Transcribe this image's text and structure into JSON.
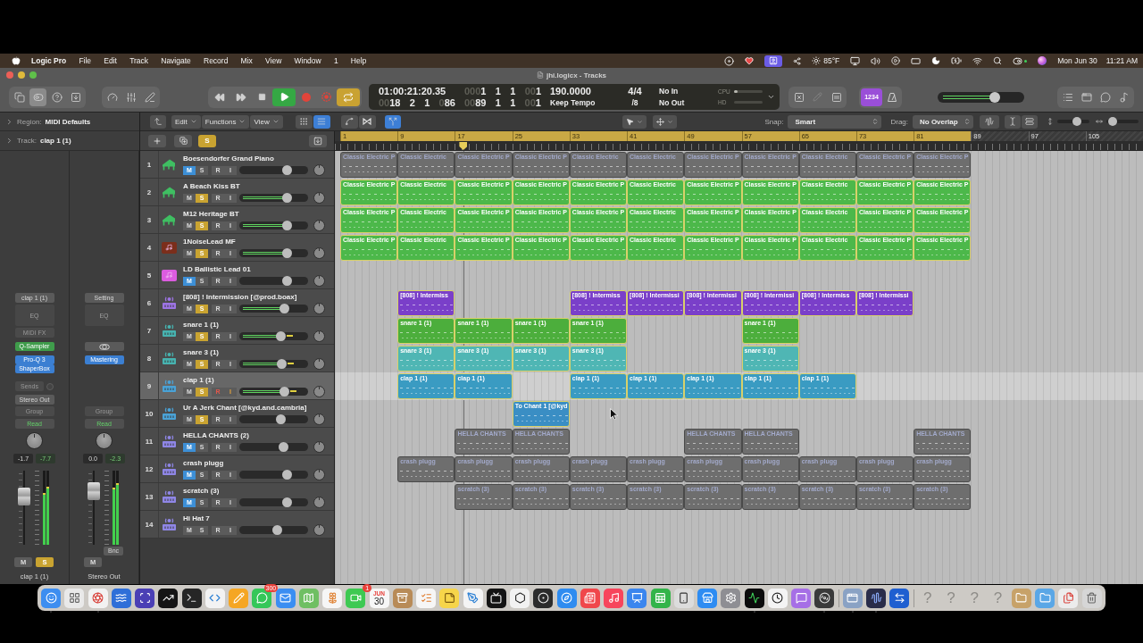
{
  "menubar": {
    "app": "Logic Pro",
    "menus": [
      "File",
      "Edit",
      "Track",
      "Navigate",
      "Record",
      "Mix",
      "View",
      "Window",
      "1",
      "Help"
    ],
    "weather": "85°F",
    "date": "Mon Jun 30",
    "time": "11:21 AM"
  },
  "window": {
    "title": "jhi.logicx - Tracks"
  },
  "toolbar": {
    "view_buttons": [
      {
        "kind": "library",
        "selected": false
      },
      {
        "kind": "inspector",
        "selected": true
      },
      {
        "kind": "help",
        "selected": false
      },
      {
        "kind": "download",
        "selected": false
      }
    ],
    "transport": {
      "playing": true,
      "cycle": true
    },
    "lcd": {
      "time": "01:00:21:20.35",
      "position": [
        {
          "dim": "00",
          "value": "18"
        },
        {
          "value": "2"
        },
        {
          "value": "1"
        },
        {
          "dim": "0",
          "value": "86"
        }
      ],
      "left_locator": [
        {
          "dim": "000",
          "value": "1"
        },
        {
          "value": "1"
        },
        {
          "value": "1"
        },
        {
          "dim": "00",
          "value": "1"
        }
      ],
      "right_locator": [
        {
          "dim": "00",
          "value": "89"
        },
        {
          "value": "1"
        },
        {
          "value": "1"
        },
        {
          "dim": "00",
          "value": "1"
        }
      ],
      "tempo": "190.0000",
      "tempo_mode": "Keep Tempo",
      "signature": "4/4",
      "division": "/8",
      "midi_in": "No In",
      "midi_out": "No Out",
      "cpu": {
        "label": "CPU",
        "level": 0.12
      },
      "hd": {
        "label": "HD"
      }
    },
    "count_in": {
      "label": "1234",
      "on": true
    },
    "master_volume": {
      "level": 0.66
    }
  },
  "inspector": {
    "region": {
      "label": "Region:",
      "value": "MIDI Defaults"
    },
    "track": {
      "label": "Track:",
      "value": "clap 1 (1)"
    }
  },
  "strips": [
    {
      "setting": "clap 1 (1)",
      "eq": "EQ",
      "midi_fx": "MIDI FX",
      "instrument": "Q-Sampler",
      "effects": [
        "Pro-Q 3",
        "ShaperBox"
      ],
      "sends": "Sends",
      "output": "Stereo Out",
      "group": "Group",
      "automation": "Read",
      "values": [
        "-1.7",
        "-7.7"
      ],
      "fader": {
        "level": 0.65
      },
      "meters": [
        {
          "level": 0.7
        },
        {
          "level": 0.78
        }
      ],
      "buttons": [
        {
          "kind": "mute",
          "label": "M",
          "on": false
        },
        {
          "kind": "solo",
          "label": "S",
          "on": true
        }
      ],
      "name": "clap 1 (1)"
    },
    {
      "setting": "Setting",
      "eq": "EQ",
      "stereo_link": true,
      "effects": [
        "Mastering"
      ],
      "group": "Group",
      "automation": "Read",
      "values": [
        "0.0",
        "-2.3"
      ],
      "fader": {
        "level": 0.72
      },
      "meters": [
        {
          "level": 0.77
        },
        {
          "level": 0.83
        }
      ],
      "bounce": "Bnc",
      "buttons": [
        {
          "kind": "mute",
          "label": "M",
          "on": false
        }
      ],
      "name": "Stereo Out"
    }
  ],
  "edit_toolbar": {
    "menus": [
      "Edit",
      "Functions",
      "View"
    ],
    "view_buttons": [
      {
        "selected": false
      },
      {
        "selected": true
      }
    ],
    "catch": {
      "on": true
    },
    "snap_label": "Snap:",
    "snap": "Smart",
    "drag_label": "Drag:",
    "drag": "No Overlap",
    "vertical_zoom": {
      "level": 0.6
    },
    "horizontal_zoom": {
      "level": 0.2
    }
  },
  "track_list": {
    "solo": {
      "label": "S",
      "on": true
    }
  },
  "ruler": {
    "marks": [
      {
        "label": "1",
        "in_cycle": true
      },
      {
        "label": "9",
        "in_cycle": true
      },
      {
        "label": "17",
        "in_cycle": true
      },
      {
        "label": "25",
        "in_cycle": true
      },
      {
        "label": "33",
        "in_cycle": true
      },
      {
        "label": "41",
        "in_cycle": true
      },
      {
        "label": "49",
        "in_cycle": true
      },
      {
        "label": "57",
        "in_cycle": true
      },
      {
        "label": "65",
        "in_cycle": true
      },
      {
        "label": "73",
        "in_cycle": true
      },
      {
        "label": "81",
        "in_cycle": true
      },
      {
        "label": "89",
        "in_cycle": false
      },
      {
        "label": "97",
        "in_cycle": false
      },
      {
        "label": "105",
        "in_cycle": false
      }
    ]
  },
  "playhead": {
    "level": 0.159
  },
  "tracks": [
    {
      "number": "1",
      "name": "Boesendorfer Grand Piano",
      "icon": {
        "kind": "piano",
        "color": "#3fbf62"
      },
      "selected": false,
      "buttons": [
        {
          "kind": "mute",
          "label": "M",
          "on": true
        },
        {
          "kind": "solo",
          "label": "S",
          "on": false
        },
        {
          "kind": "record",
          "label": "R",
          "on": false
        },
        {
          "kind": "input",
          "label": "I",
          "on": false
        }
      ],
      "level": 0.7,
      "signal": false,
      "peak": false,
      "regions": [
        {
          "kind": "region",
          "name": "Classic Electric P"
        },
        {
          "kind": "region",
          "name": "Classic Electric"
        },
        {
          "kind": "region",
          "name": "Classic Electric P"
        },
        {
          "kind": "region",
          "name": "Classic Electric P"
        },
        {
          "kind": "region",
          "name": "Classic Electric"
        },
        {
          "kind": "region",
          "name": "Classic Electric"
        },
        {
          "kind": "region",
          "name": "Classic Electric P"
        },
        {
          "kind": "region",
          "name": "Classic Electric P"
        },
        {
          "kind": "region",
          "name": "Classic Electric"
        },
        {
          "kind": "region",
          "name": "Classic Electric P"
        },
        {
          "kind": "region",
          "name": "Classic Electric P"
        }
      ]
    },
    {
      "number": "2",
      "name": "A Beach Kiss BT",
      "icon": {
        "kind": "piano",
        "color": "#3fbf62"
      },
      "color": "#4cb84a",
      "selected": false,
      "buttons": [
        {
          "kind": "mute",
          "label": "M",
          "on": false
        },
        {
          "kind": "solo",
          "label": "S",
          "on": true
        },
        {
          "kind": "record",
          "label": "R",
          "on": false
        },
        {
          "kind": "input",
          "label": "I",
          "on": false
        }
      ],
      "level": 0.7,
      "signal": true,
      "peak": false,
      "regions": [
        {
          "kind": "region",
          "name": "Classic Electric P"
        },
        {
          "kind": "region",
          "name": "Classic Electric"
        },
        {
          "kind": "region",
          "name": "Classic Electric P"
        },
        {
          "kind": "region",
          "name": "Classic Electric P"
        },
        {
          "kind": "region",
          "name": "Classic Electric P"
        },
        {
          "kind": "region",
          "name": "Classic Electric"
        },
        {
          "kind": "region",
          "name": "Classic Electric P"
        },
        {
          "kind": "region",
          "name": "Classic Electric P"
        },
        {
          "kind": "region",
          "name": "Classic Electric"
        },
        {
          "kind": "region",
          "name": "Classic Electric P"
        },
        {
          "kind": "region",
          "name": "Classic Electric P"
        }
      ]
    },
    {
      "number": "3",
      "name": "M12 Heritage BT",
      "icon": {
        "kind": "piano",
        "color": "#3fbf62"
      },
      "color": "#4cb84a",
      "selected": false,
      "buttons": [
        {
          "kind": "mute",
          "label": "M",
          "on": false
        },
        {
          "kind": "solo",
          "label": "S",
          "on": true
        },
        {
          "kind": "record",
          "label": "R",
          "on": false
        },
        {
          "kind": "input",
          "label": "I",
          "on": false
        }
      ],
      "level": 0.7,
      "signal": true,
      "peak": false,
      "regions": [
        {
          "kind": "region",
          "name": "Classic Electric P"
        },
        {
          "kind": "region",
          "name": "Classic Electric"
        },
        {
          "kind": "region",
          "name": "Classic Electric P"
        },
        {
          "kind": "region",
          "name": "Classic Electric P"
        },
        {
          "kind": "region",
          "name": "Classic Electric P"
        },
        {
          "kind": "region",
          "name": "Classic Electric"
        },
        {
          "kind": "region",
          "name": "Classic Electric P"
        },
        {
          "kind": "region",
          "name": "Classic Electric P"
        },
        {
          "kind": "region",
          "name": "Classic Electric"
        },
        {
          "kind": "region",
          "name": "Classic Electric P"
        },
        {
          "kind": "region",
          "name": "Classic Electric P"
        }
      ]
    },
    {
      "number": "4",
      "name": "1NoiseLead MF",
      "icon": {
        "kind": "note",
        "color": "#7b2e1b"
      },
      "color": "#4cb84a",
      "selected": false,
      "buttons": [
        {
          "kind": "mute",
          "label": "M",
          "on": false
        },
        {
          "kind": "solo",
          "label": "S",
          "on": true
        },
        {
          "kind": "record",
          "label": "R",
          "on": false
        },
        {
          "kind": "input",
          "label": "I",
          "on": false
        }
      ],
      "level": 0.7,
      "signal": true,
      "peak": false,
      "regions": [
        {
          "kind": "region",
          "name": "Classic Electric P"
        },
        {
          "kind": "region",
          "name": "Classic Electric"
        },
        {
          "kind": "region",
          "name": "Classic Electric P"
        },
        {
          "kind": "region",
          "name": "Classic Electric P"
        },
        {
          "kind": "region",
          "name": "Classic Electric P"
        },
        {
          "kind": "region",
          "name": "Classic Electric"
        },
        {
          "kind": "region",
          "name": "Classic Electric P"
        },
        {
          "kind": "region",
          "name": "Classic Electric P"
        },
        {
          "kind": "region",
          "name": "Classic Electric"
        },
        {
          "kind": "region",
          "name": "Classic Electric P"
        },
        {
          "kind": "region",
          "name": "Classic Electric P"
        }
      ]
    },
    {
      "number": "5",
      "name": "LD Ballistic Lead 01",
      "icon": {
        "kind": "note",
        "color": "#dc5ce0"
      },
      "selected": false,
      "buttons": [
        {
          "kind": "mute",
          "label": "M",
          "on": true
        },
        {
          "kind": "solo",
          "label": "S",
          "on": false
        },
        {
          "kind": "record",
          "label": "R",
          "on": false
        },
        {
          "kind": "input",
          "label": "I",
          "on": false
        }
      ],
      "level": 0.7,
      "signal": false,
      "peak": false
    },
    {
      "number": "6",
      "name": "[808] ! Intermission [@prod.boax]",
      "icon": {
        "kind": "drums",
        "color": "#9d74e4"
      },
      "color": "#7a3fc9",
      "selected": false,
      "buttons": [
        {
          "kind": "mute",
          "label": "M",
          "on": false
        },
        {
          "kind": "solo",
          "label": "S",
          "on": true
        },
        {
          "kind": "record",
          "label": "R",
          "on": false
        },
        {
          "kind": "input",
          "label": "I",
          "on": false
        }
      ],
      "level": 0.66,
      "signal": true,
      "peak": false,
      "regions": [
        {
          "kind": "gap"
        },
        {
          "kind": "region",
          "name": "[808] ! Intermiss"
        },
        {
          "kind": "gap"
        },
        {
          "kind": "gap"
        },
        {
          "kind": "region",
          "name": "[808] ! Intermiss"
        },
        {
          "kind": "region",
          "name": "[808] ! Intermissi"
        },
        {
          "kind": "region",
          "name": "[808] ! Intermissi"
        },
        {
          "kind": "region",
          "name": "[808] ! Intermissi"
        },
        {
          "kind": "region",
          "name": "[808] ! Intermiss"
        },
        {
          "kind": "region",
          "name": "[808] ! Intermissi"
        }
      ]
    },
    {
      "number": "7",
      "name": "snare 1 (1)",
      "icon": {
        "kind": "drums",
        "color": "#47b3b0"
      },
      "color": "#4cae3c",
      "selected": false,
      "buttons": [
        {
          "kind": "mute",
          "label": "M",
          "on": false
        },
        {
          "kind": "solo",
          "label": "S",
          "on": true
        },
        {
          "kind": "record",
          "label": "R",
          "on": false
        },
        {
          "kind": "input",
          "label": "I",
          "on": false
        }
      ],
      "level": 0.61,
      "signal": true,
      "peak": true,
      "regions": [
        {
          "kind": "gap"
        },
        {
          "kind": "region",
          "name": "snare 1 (1)"
        },
        {
          "kind": "region",
          "name": "snare 1 (1)"
        },
        {
          "kind": "region",
          "name": "snare 1 (1)"
        },
        {
          "kind": "region",
          "name": "snare 1 (1)"
        },
        {
          "kind": "gap"
        },
        {
          "kind": "gap"
        },
        {
          "kind": "region",
          "name": "snare 1 (1)"
        }
      ]
    },
    {
      "number": "8",
      "name": "snare 3 (1)",
      "icon": {
        "kind": "drums",
        "color": "#47b3b0"
      },
      "color": "#4fb6b4",
      "selected": false,
      "buttons": [
        {
          "kind": "mute",
          "label": "M",
          "on": false
        },
        {
          "kind": "solo",
          "label": "S",
          "on": true
        },
        {
          "kind": "record",
          "label": "R",
          "on": false
        },
        {
          "kind": "input",
          "label": "I",
          "on": false
        }
      ],
      "level": 0.62,
      "signal": true,
      "peak": true,
      "regions": [
        {
          "kind": "gap"
        },
        {
          "kind": "region",
          "name": "snare 3 (1)"
        },
        {
          "kind": "region",
          "name": "snare 3 (1)"
        },
        {
          "kind": "region",
          "name": "snare 3 (1)"
        },
        {
          "kind": "region",
          "name": "snare 3 (1)"
        },
        {
          "kind": "gap"
        },
        {
          "kind": "gap"
        },
        {
          "kind": "region",
          "name": "snare 3 (1)"
        }
      ]
    },
    {
      "number": "9",
      "name": "clap 1 (1)",
      "icon": {
        "kind": "drums",
        "color": "#4aa2d6"
      },
      "color": "#3a9bc2",
      "selected": true,
      "buttons": [
        {
          "kind": "mute",
          "label": "M",
          "on": false
        },
        {
          "kind": "solo",
          "label": "S",
          "on": true
        },
        {
          "kind": "record",
          "label": "R",
          "on": true
        },
        {
          "kind": "input",
          "label": "I",
          "on": true
        }
      ],
      "level": 0.66,
      "signal": true,
      "peak": true,
      "regions": [
        {
          "kind": "gap"
        },
        {
          "kind": "region",
          "name": "clap 1 (1)"
        },
        {
          "kind": "region",
          "name": "clap 1 (1)"
        },
        {
          "kind": "gap"
        },
        {
          "kind": "region",
          "name": "clap 1 (1)"
        },
        {
          "kind": "region",
          "name": "clap 1 (1)"
        },
        {
          "kind": "region",
          "name": "clap 1 (1)"
        },
        {
          "kind": "region",
          "name": "clap 1 (1)"
        },
        {
          "kind": "region",
          "name": "clap 1 (1)"
        }
      ]
    },
    {
      "number": "10",
      "name": "Ur A Jerk Chant [@kyd.and.cambria]",
      "icon": {
        "kind": "drums",
        "color": "#4aa2d6"
      },
      "color": "#3a8ec4",
      "selected": false,
      "buttons": [
        {
          "kind": "mute",
          "label": "M",
          "on": false
        },
        {
          "kind": "solo",
          "label": "S",
          "on": true
        },
        {
          "kind": "record",
          "label": "R",
          "on": false
        },
        {
          "kind": "input",
          "label": "I",
          "on": false
        }
      ],
      "level": 0.61,
      "signal": false,
      "peak": false,
      "regions": [
        {
          "kind": "gap"
        },
        {
          "kind": "gap"
        },
        {
          "kind": "gap"
        },
        {
          "kind": "region",
          "name": "To Chant 1 [@kyd"
        }
      ]
    },
    {
      "number": "11",
      "name": "HELLA CHANTS (2)",
      "icon": {
        "kind": "drums",
        "color": "#8f86e6"
      },
      "selected": false,
      "buttons": [
        {
          "kind": "mute",
          "label": "M",
          "on": true
        },
        {
          "kind": "solo",
          "label": "S",
          "on": false
        },
        {
          "kind": "record",
          "label": "R",
          "on": false
        },
        {
          "kind": "input",
          "label": "I",
          "on": false
        }
      ],
      "level": 0.64,
      "signal": false,
      "peak": false,
      "regions": [
        {
          "kind": "gap"
        },
        {
          "kind": "gap"
        },
        {
          "kind": "region",
          "name": "HELLA CHANTS"
        },
        {
          "kind": "region",
          "name": "HELLA CHANTS"
        },
        {
          "kind": "gap"
        },
        {
          "kind": "gap"
        },
        {
          "kind": "region",
          "name": "HELLA CHANTS"
        },
        {
          "kind": "region",
          "name": "HELLA CHANTS"
        },
        {
          "kind": "gap"
        },
        {
          "kind": "gap"
        },
        {
          "kind": "region",
          "name": "HELLA CHANTS"
        }
      ]
    },
    {
      "number": "12",
      "name": "crash plugg",
      "icon": {
        "kind": "drums",
        "color": "#8f86e6"
      },
      "selected": false,
      "buttons": [
        {
          "kind": "mute",
          "label": "M",
          "on": true
        },
        {
          "kind": "solo",
          "label": "S",
          "on": false
        },
        {
          "kind": "record",
          "label": "R",
          "on": false
        },
        {
          "kind": "input",
          "label": "I",
          "on": false
        }
      ],
      "level": 0.7,
      "signal": false,
      "peak": false,
      "regions": [
        {
          "kind": "gap"
        },
        {
          "kind": "region",
          "name": "crash plugg"
        },
        {
          "kind": "region",
          "name": "crash plugg"
        },
        {
          "kind": "region",
          "name": "crash plugg"
        },
        {
          "kind": "region",
          "name": "crash plugg"
        },
        {
          "kind": "region",
          "name": "crash plugg"
        },
        {
          "kind": "region",
          "name": "crash plugg"
        },
        {
          "kind": "region",
          "name": "crash plugg"
        },
        {
          "kind": "region",
          "name": "crash plugg"
        },
        {
          "kind": "region",
          "name": "crash plugg"
        },
        {
          "kind": "region",
          "name": "crash plugg"
        }
      ]
    },
    {
      "number": "13",
      "name": "scratch (3)",
      "icon": {
        "kind": "drums",
        "color": "#8f86e6"
      },
      "selected": false,
      "buttons": [
        {
          "kind": "mute",
          "label": "M",
          "on": true
        },
        {
          "kind": "solo",
          "label": "S",
          "on": false
        },
        {
          "kind": "record",
          "label": "R",
          "on": false
        },
        {
          "kind": "input",
          "label": "I",
          "on": false
        }
      ],
      "level": 0.7,
      "signal": false,
      "peak": false,
      "regions": [
        {
          "kind": "gap"
        },
        {
          "kind": "gap"
        },
        {
          "kind": "region",
          "name": "scratch (3)"
        },
        {
          "kind": "region",
          "name": "scratch (3)"
        },
        {
          "kind": "region",
          "name": "scratch (3)"
        },
        {
          "kind": "region",
          "name": "scratch (3)"
        },
        {
          "kind": "region",
          "name": "scratch (3)"
        },
        {
          "kind": "region",
          "name": "scratch (3)"
        },
        {
          "kind": "region",
          "name": "scratch (3)"
        },
        {
          "kind": "region",
          "name": "scratch (3)"
        },
        {
          "kind": "region",
          "name": "scratch (3)"
        }
      ]
    },
    {
      "number": "14",
      "name": "Hi Hat 7",
      "icon": {
        "kind": "drums",
        "color": "#8f86e6"
      },
      "selected": false,
      "buttons": [
        {
          "kind": "mute",
          "label": "M",
          "on": false
        },
        {
          "kind": "solo",
          "label": "S",
          "on": false
        },
        {
          "kind": "record",
          "label": "R",
          "on": false
        },
        {
          "kind": "input",
          "label": "I",
          "on": false
        }
      ],
      "level": 0.55,
      "signal": false,
      "peak": false
    }
  ],
  "dock": {
    "items": [
      {
        "kind": "smiley",
        "color": "#3d8ef0",
        "running": true
      },
      {
        "kind": "grid",
        "color": "#e9e9e9",
        "running": false
      },
      {
        "kind": "aperture",
        "color": "#f2f2f2",
        "running": true
      },
      {
        "kind": "waves",
        "color": "#2f6fd8",
        "running": false
      },
      {
        "kind": "scan",
        "color": "#4a3fb5",
        "running": false
      },
      {
        "kind": "trend",
        "color": "#151515",
        "running": false
      },
      {
        "kind": "terminal",
        "color": "#262626",
        "running": false
      },
      {
        "kind": "code",
        "color": "#f3f3f3",
        "running": false
      },
      {
        "kind": "pencil",
        "color": "#f5a623",
        "running": false
      },
      {
        "kind": "chat",
        "color": "#35c759",
        "running": false,
        "badge": "300"
      },
      {
        "kind": "mail",
        "color": "#3b8ef2",
        "running": false
      },
      {
        "kind": "map",
        "color": "#6fbf63",
        "running": false
      },
      {
        "kind": "flower",
        "color": "#f6f6f6",
        "running": false
      },
      {
        "kind": "video",
        "color": "#3ec952",
        "running": false,
        "badge": "1"
      },
      {
        "kind": "calendar",
        "color": "#f7f7f7",
        "running": false,
        "month": "JUN",
        "day": "30"
      },
      {
        "kind": "archive",
        "color": "#b88b57",
        "running": false
      },
      {
        "kind": "checklist",
        "color": "#f6f6f6",
        "running": false
      },
      {
        "kind": "note",
        "color": "#f6d54a",
        "running": false
      },
      {
        "kind": "pen",
        "color": "#f4f4f4",
        "running": false
      },
      {
        "kind": "tv",
        "color": "#141414",
        "running": false
      },
      {
        "kind": "hexagon",
        "color": "#f2f2f2",
        "running": false
      },
      {
        "kind": "dot",
        "color": "#2c2c2c",
        "running": false
      },
      {
        "kind": "compass",
        "color": "#2f8cf0",
        "running": false
      },
      {
        "kind": "news",
        "color": "#f0474b",
        "running": false
      },
      {
        "kind": "music",
        "color": "#f7455c",
        "running": false
      },
      {
        "kind": "slides",
        "color": "#3b86ee",
        "running": false
      },
      {
        "kind": "sheet",
        "color": "#33b44a",
        "running": false
      },
      {
        "kind": "phone",
        "color": "#dcdcdc",
        "running": false
      },
      {
        "kind": "store",
        "color": "#2e8cf2",
        "running": false
      },
      {
        "kind": "gear",
        "color": "#8e8e93",
        "running": false
      },
      {
        "kind": "pulse",
        "color": "#0c0c0c",
        "running": true
      },
      {
        "kind": "clock",
        "color": "#f4f4f4",
        "running": false
      },
      {
        "kind": "speech",
        "color": "#a66fe6",
        "running": false
      },
      {
        "kind": "disc",
        "color": "#3a3a3a",
        "running": true
      },
      {
        "kind": "separator"
      },
      {
        "kind": "window",
        "color": "#8aa2c4",
        "running": true
      },
      {
        "kind": "waveform",
        "color": "#2a2d4a",
        "running": true
      },
      {
        "kind": "arrows",
        "color": "#1f5fd0",
        "running": false
      },
      {
        "kind": "separator"
      },
      {
        "kind": "missing",
        "glyph": "?"
      },
      {
        "kind": "missing",
        "glyph": "?"
      },
      {
        "kind": "missing",
        "glyph": "?"
      },
      {
        "kind": "missing",
        "glyph": "?"
      },
      {
        "kind": "folder",
        "color": "#c7a269",
        "running": false
      },
      {
        "kind": "folder",
        "color": "#5aa7e6",
        "running": false
      },
      {
        "kind": "files",
        "color": "#ececec",
        "running": false
      },
      {
        "kind": "trash",
        "color": "#d6d6d6",
        "running": false
      }
    ]
  }
}
